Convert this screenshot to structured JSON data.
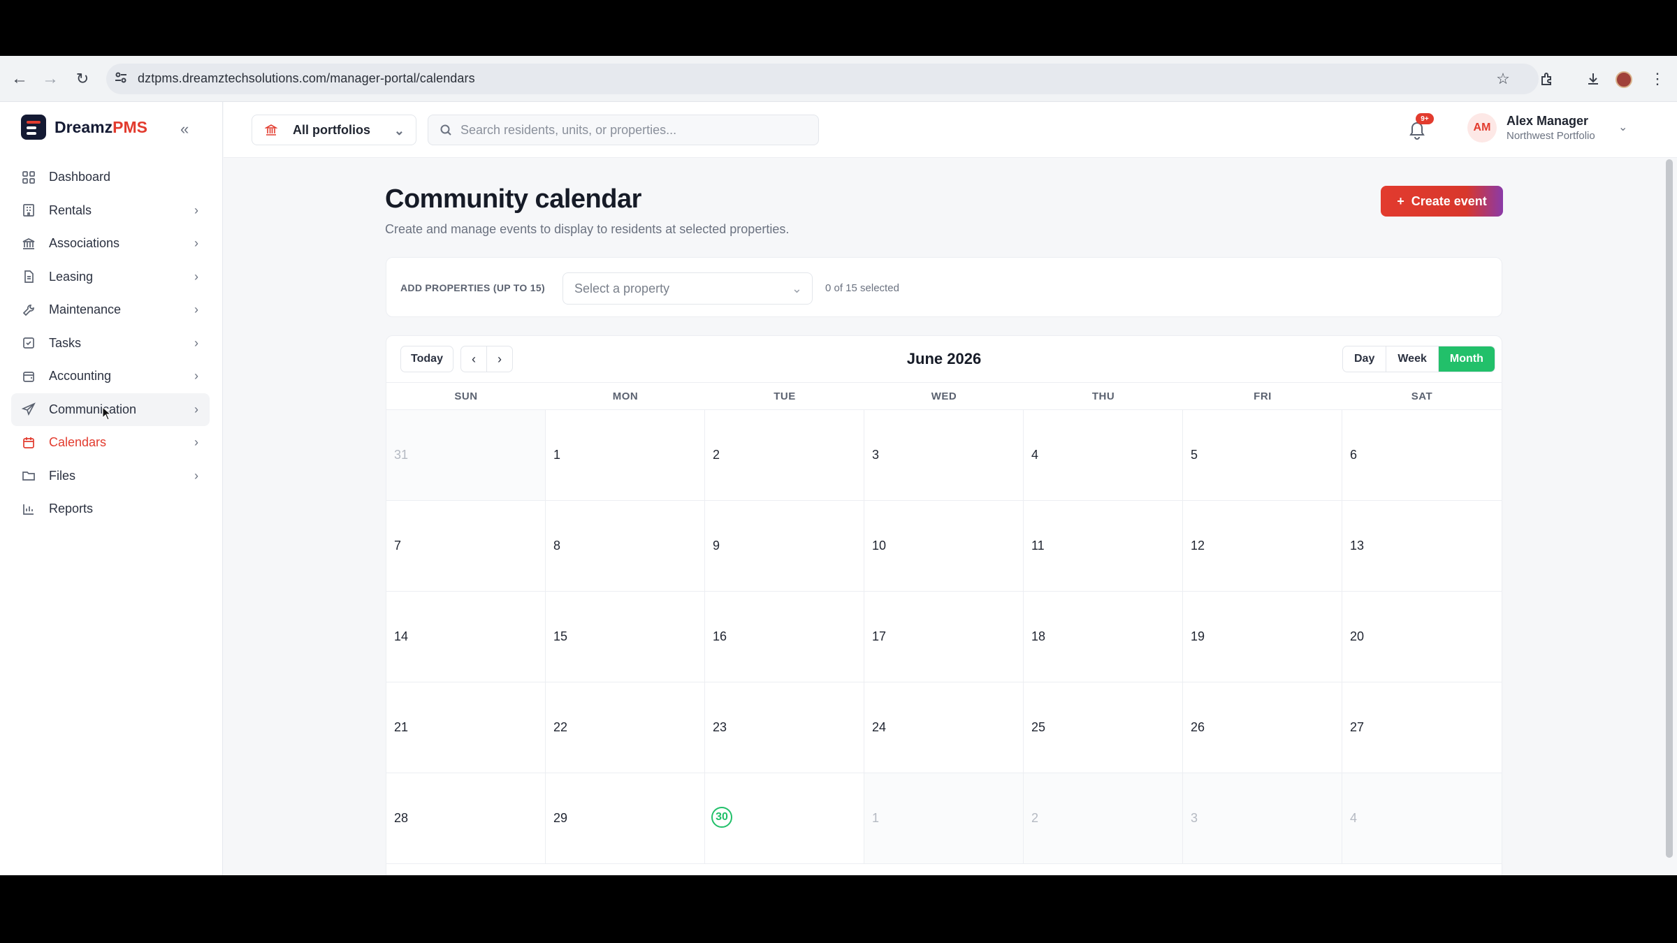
{
  "browser": {
    "url": "dztpms.dreamztechsolutions.com/manager-portal/calendars",
    "back_icon": "arrow-left-icon",
    "forward_icon": "arrow-right-icon",
    "reload_icon": "reload-icon"
  },
  "app": {
    "brand_name": "Dreamz",
    "brand_accent": "PMS",
    "accent_color": "#e23b2e",
    "success_color": "#22c06a"
  },
  "sidebar": {
    "items": [
      {
        "label": "Dashboard",
        "icon": "grid-icon",
        "has_chevron": false
      },
      {
        "label": "Rentals",
        "icon": "building-icon",
        "has_chevron": true
      },
      {
        "label": "Associations",
        "icon": "bank-icon",
        "has_chevron": true
      },
      {
        "label": "Leasing",
        "icon": "document-icon",
        "has_chevron": true
      },
      {
        "label": "Maintenance",
        "icon": "wrench-icon",
        "has_chevron": true
      },
      {
        "label": "Tasks",
        "icon": "checkbox-icon",
        "has_chevron": true
      },
      {
        "label": "Accounting",
        "icon": "wallet-icon",
        "has_chevron": true
      },
      {
        "label": "Communication",
        "icon": "send-icon",
        "has_chevron": true
      },
      {
        "label": "Calendars",
        "icon": "calendar-icon",
        "has_chevron": true
      },
      {
        "label": "Files",
        "icon": "folder-icon",
        "has_chevron": true
      },
      {
        "label": "Reports",
        "icon": "bar-chart-icon",
        "has_chevron": false
      }
    ],
    "active": "Calendars",
    "hovered": "Communication"
  },
  "header": {
    "portfolio_label": "All portfolios",
    "search_placeholder": "Search residents, units, or properties...",
    "notification_badge": "9+",
    "user_initials": "AM",
    "user_name": "Alex Manager",
    "user_portfolio": "Northwest Portfolio"
  },
  "page": {
    "title": "Community calendar",
    "subtitle": "Create and manage events to display to residents at selected properties.",
    "create_button": "Create event"
  },
  "properties": {
    "label": "ADD PROPERTIES (UP TO 15)",
    "select_placeholder": "Select a property",
    "count_text": "0 of 15 selected"
  },
  "calendar": {
    "today_button": "Today",
    "month_title": "June 2026",
    "views": [
      "Day",
      "Week",
      "Month"
    ],
    "active_view": "Month",
    "weekdays": [
      "SUN",
      "MON",
      "TUE",
      "WED",
      "THU",
      "FRI",
      "SAT"
    ],
    "days": [
      {
        "n": "31",
        "outside": true
      },
      {
        "n": "1"
      },
      {
        "n": "2"
      },
      {
        "n": "3"
      },
      {
        "n": "4"
      },
      {
        "n": "5"
      },
      {
        "n": "6"
      },
      {
        "n": "7"
      },
      {
        "n": "8"
      },
      {
        "n": "9"
      },
      {
        "n": "10"
      },
      {
        "n": "11"
      },
      {
        "n": "12"
      },
      {
        "n": "13"
      },
      {
        "n": "14"
      },
      {
        "n": "15"
      },
      {
        "n": "16"
      },
      {
        "n": "17"
      },
      {
        "n": "18"
      },
      {
        "n": "19"
      },
      {
        "n": "20"
      },
      {
        "n": "21"
      },
      {
        "n": "22"
      },
      {
        "n": "23"
      },
      {
        "n": "24"
      },
      {
        "n": "25"
      },
      {
        "n": "26"
      },
      {
        "n": "27"
      },
      {
        "n": "28"
      },
      {
        "n": "29"
      },
      {
        "n": "30",
        "today": true
      },
      {
        "n": "1",
        "outside": true
      },
      {
        "n": "2",
        "outside": true
      },
      {
        "n": "3",
        "outside": true
      },
      {
        "n": "4",
        "outside": true
      }
    ]
  }
}
